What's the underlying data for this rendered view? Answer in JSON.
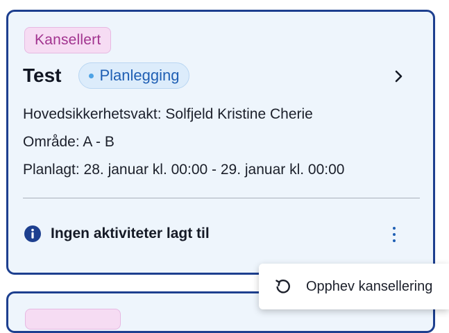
{
  "card": {
    "status_label": "Kansellert",
    "title": "Test",
    "phase_label": "Planlegging",
    "details": [
      "Hovedsikkerhetsvakt: Solfjeld Kristine Cherie",
      "Område: A - B",
      "Planlagt: 28. januar kl. 00:00 - 29. januar kl. 00:00"
    ],
    "footer_text": "Ingen aktiviteter lagt til",
    "icons": {
      "open": "chevron-right-icon",
      "info": "info-circle-icon",
      "more": "more-vertical-icon"
    }
  },
  "context_menu": {
    "items": [
      {
        "label": "Opphev kansellering",
        "icon": "undo-icon"
      }
    ]
  },
  "colors": {
    "card_border": "#1d3f8f",
    "card_background": "#eef5fc",
    "status_chip_bg": "#f6dcf3",
    "status_chip_text": "#a1338f",
    "phase_chip_bg": "#dcecfb",
    "phase_chip_text": "#1f5fb4",
    "accent": "#1f5fb4"
  }
}
